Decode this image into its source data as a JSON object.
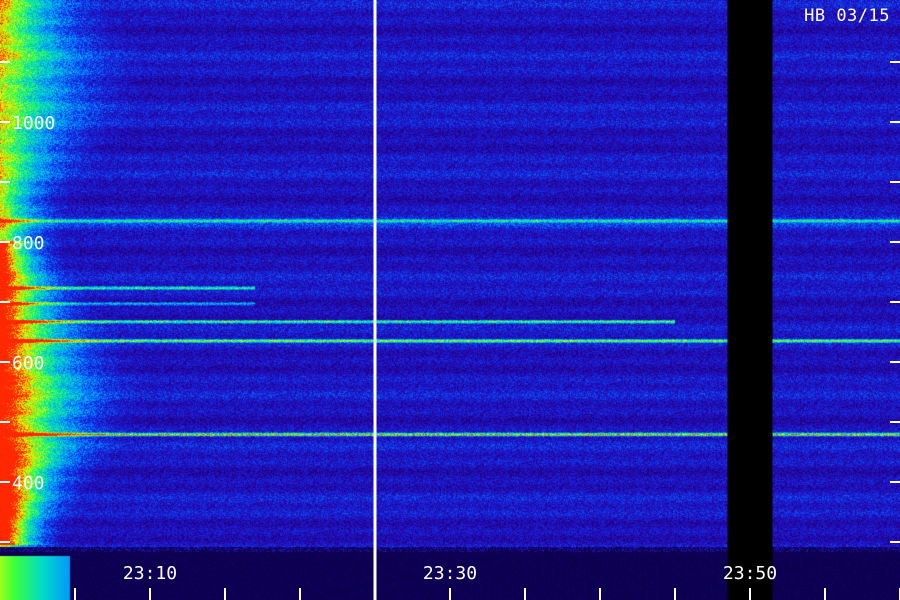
{
  "label": "HB 03/15",
  "colors": {
    "background": "#000000",
    "ticks": "#ffffff",
    "low": "#1a00a0",
    "mid": "#00c8c8",
    "high": "#ffff00",
    "peak": "#ff4000"
  },
  "chart_data": {
    "type": "heatmap",
    "title": "",
    "xlabel": "",
    "ylabel": "",
    "x_tick_labels": [
      "23:10",
      "23:30",
      "23:50"
    ],
    "x_tick_minutes": [
      10,
      30,
      50
    ],
    "x_range_minutes": [
      0,
      60
    ],
    "y_tick_labels": [
      "400",
      "600",
      "800",
      "1000"
    ],
    "y_tick_values": [
      400,
      600,
      800,
      1000
    ],
    "y_range": [
      300,
      1100
    ],
    "divider_minute": 25,
    "gap_minutes": [
      48.5,
      51.5
    ],
    "bands": [
      {
        "value": 480,
        "strength": 0.95,
        "ends_minute": 60
      },
      {
        "value": 636,
        "strength": 0.8,
        "ends_minute": 60
      },
      {
        "value": 668,
        "strength": 0.8,
        "ends_minute": 45
      },
      {
        "value": 698,
        "strength": 0.55,
        "ends_minute": 17
      },
      {
        "value": 724,
        "strength": 0.7,
        "ends_minute": 17
      },
      {
        "value": 836,
        "strength": 0.45,
        "ends_minute": 60
      }
    ]
  }
}
